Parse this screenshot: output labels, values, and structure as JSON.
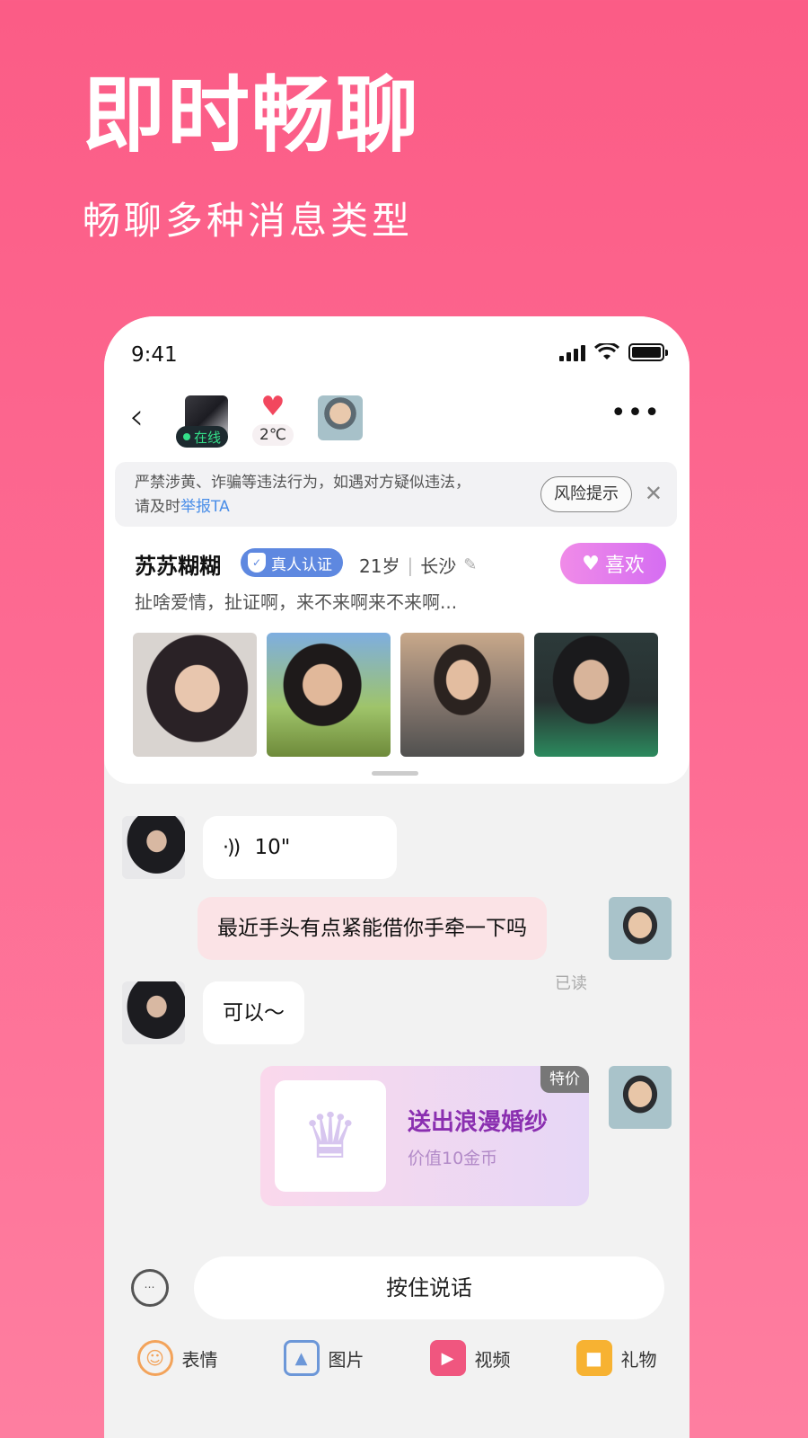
{
  "hero": {
    "title": "即时畅聊",
    "subtitle": "畅聊多种消息类型"
  },
  "status_bar": {
    "time": "9:41"
  },
  "header": {
    "online_label": "在线",
    "temperature": "2℃",
    "more_label": "•••",
    "back_label": "‹"
  },
  "notice": {
    "text_line1": "严禁涉黄、诈骗等违法行为，如遇对方疑似违法，",
    "text_prefix": "请及时",
    "report_link": "举报TA",
    "risk_button": "风险提示",
    "close_label": "✕"
  },
  "profile": {
    "name": "苏苏糊糊",
    "verify_label": "真人认证",
    "age": "21岁",
    "city": "长沙",
    "like_label": "喜欢",
    "bio": "扯啥爱情，扯证啊，来不来啊来不来啊..."
  },
  "messages": {
    "voice_duration": "10\"",
    "sent_text": "最近手头有点紧能借你手牵一下吗",
    "read_status": "已读",
    "reply_text": "可以～"
  },
  "gift": {
    "tag": "特价",
    "title": "送出浪漫婚纱",
    "value": "价值10金币"
  },
  "input": {
    "voice_button": "按住说话"
  },
  "toolbar": {
    "emoji": "表情",
    "image": "图片",
    "video": "视频",
    "gift": "礼物"
  },
  "colors": {
    "background": "#fb5c86",
    "like_button": "#d56df2",
    "verify_badge": "#5e88e0",
    "gift_title": "#8a2fb0",
    "report_link": "#4a8ee8"
  }
}
